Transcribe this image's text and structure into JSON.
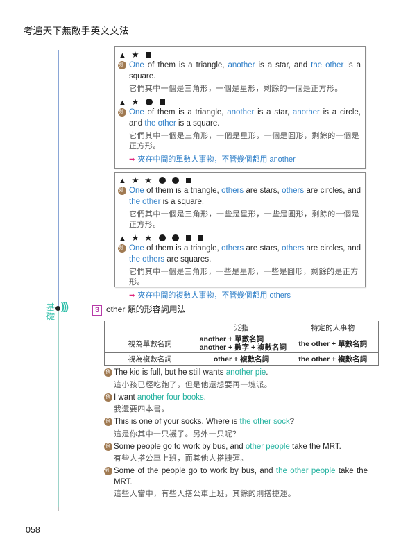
{
  "book_title": "考遍天下無敵手英文文法",
  "page_number": "058",
  "level": {
    "label_line1": "基",
    "label_line2": "礎",
    "waves": ")))"
  },
  "box1": {
    "group1": {
      "shapes": [
        "triangle",
        "star",
        "square"
      ],
      "badge": "例",
      "en_parts": [
        {
          "text": "One",
          "hl": true
        },
        {
          "text": " of them is a triangle, ",
          "hl": false
        },
        {
          "text": "another",
          "hl": true
        },
        {
          "text": " is a star, and ",
          "hl": false
        },
        {
          "text": "the other",
          "hl": true
        },
        {
          "text": " is a square.",
          "hl": false
        }
      ],
      "zh": "它們其中一個是三角形，一個是星形，剩餘的一個是正方形。"
    },
    "group2": {
      "shapes": [
        "triangle",
        "star",
        "circle",
        "square"
      ],
      "badge": "例",
      "en_parts": [
        {
          "text": "One",
          "hl": true
        },
        {
          "text": " of them is a triangle, ",
          "hl": false
        },
        {
          "text": "another",
          "hl": true
        },
        {
          "text": " is a star, ",
          "hl": false
        },
        {
          "text": "another",
          "hl": true
        },
        {
          "text": " is a circle, and ",
          "hl": false
        },
        {
          "text": "the other",
          "hl": true
        },
        {
          "text": " is a square.",
          "hl": false
        }
      ],
      "zh": "它們其中一個是三角形，一個是星形，一個是圓形，剩餘的一個是正方形。"
    },
    "note": {
      "arrow": "➡",
      "text": "夾在中間的單數人事物，不管幾個都用 another"
    }
  },
  "box2": {
    "group1": {
      "shapes": [
        "triangle",
        "star",
        "star",
        "circle",
        "circle",
        "square"
      ],
      "badge": "例",
      "en_parts": [
        {
          "text": "One",
          "hl": true
        },
        {
          "text": " of them is a triangle, ",
          "hl": false
        },
        {
          "text": "others",
          "hl": true
        },
        {
          "text": " are stars, ",
          "hl": false
        },
        {
          "text": "others",
          "hl": true
        },
        {
          "text": " are circles, and ",
          "hl": false
        },
        {
          "text": "the other",
          "hl": true
        },
        {
          "text": " is a square.",
          "hl": false
        }
      ],
      "zh": "它們其中一個是三角形，一些是星形，一些是圓形，剩餘的一個是正方形。"
    },
    "group2": {
      "shapes": [
        "triangle",
        "star",
        "star",
        "circle",
        "circle",
        "square",
        "square"
      ],
      "badge": "例",
      "en_parts": [
        {
          "text": "One",
          "hl": true
        },
        {
          "text": " of them is a triangle, ",
          "hl": false
        },
        {
          "text": "others",
          "hl": true
        },
        {
          "text": " are stars, ",
          "hl": false
        },
        {
          "text": "others",
          "hl": true
        },
        {
          "text": " are circles, and ",
          "hl": false
        },
        {
          "text": "the others",
          "hl": true
        },
        {
          "text": " are squares.",
          "hl": false
        }
      ],
      "zh": "它們其中一個是三角形，一些是星形，一些是圓形，剩餘的是正方形。"
    },
    "note": {
      "arrow": "➡",
      "text": "夾在中間的複數人事物，不管幾個都用 others"
    }
  },
  "section": {
    "number": "3",
    "title": "other 類的形容詞用法"
  },
  "table": {
    "headers": [
      "",
      "泛指",
      "特定的人事物"
    ],
    "rows": [
      {
        "label": "視為單數名詞",
        "general": [
          "another + 單數名詞",
          "another + 數字 + 複數名詞"
        ],
        "specific": "the other  + 單數名詞"
      },
      {
        "label": "視為複數名詞",
        "general": [
          "other + 複數名詞"
        ],
        "specific": "the other  + 複數名詞"
      }
    ]
  },
  "examples": [
    {
      "badge": "例",
      "en_parts": [
        {
          "text": "The kid is full, but he still wants ",
          "hl": false
        },
        {
          "text": "another pie",
          "hl": true
        },
        {
          "text": ".",
          "hl": false
        }
      ],
      "zh": "這小孩已經吃飽了，但是他還想要再一塊派。"
    },
    {
      "badge": "例",
      "en_parts": [
        {
          "text": "I want ",
          "hl": false
        },
        {
          "text": "another four books",
          "hl": true
        },
        {
          "text": ".",
          "hl": false
        }
      ],
      "zh": "我還要四本書。"
    },
    {
      "badge": "例",
      "en_parts": [
        {
          "text": "This is one of your socks. Where is ",
          "hl": false
        },
        {
          "text": "the other sock",
          "hl": true
        },
        {
          "text": "?",
          "hl": false
        }
      ],
      "zh": "這是你其中一只襪子。另外一只呢？"
    },
    {
      "badge": "例",
      "en_parts": [
        {
          "text": "Some people go to work by bus, and ",
          "hl": false
        },
        {
          "text": "other people",
          "hl": true
        },
        {
          "text": " take the MRT.",
          "hl": false
        }
      ],
      "zh": "有些人搭公車上班，而其他人搭捷運。"
    },
    {
      "badge": "例",
      "en_parts": [
        {
          "text": "Some of the people go to work by bus, and ",
          "hl": false
        },
        {
          "text": "the other people",
          "hl": true
        },
        {
          "text": " take the MRT.",
          "hl": false
        }
      ],
      "zh": "這些人當中，有些人搭公車上班，其餘的則搭捷運。"
    }
  ],
  "colors": {
    "highlight_blue": "#2f7fc8",
    "highlight_teal": "#27b3a1",
    "arrow_pink": "#e0257b",
    "section_purple": "#b63aa8",
    "badge_brown": "#a07a52"
  }
}
